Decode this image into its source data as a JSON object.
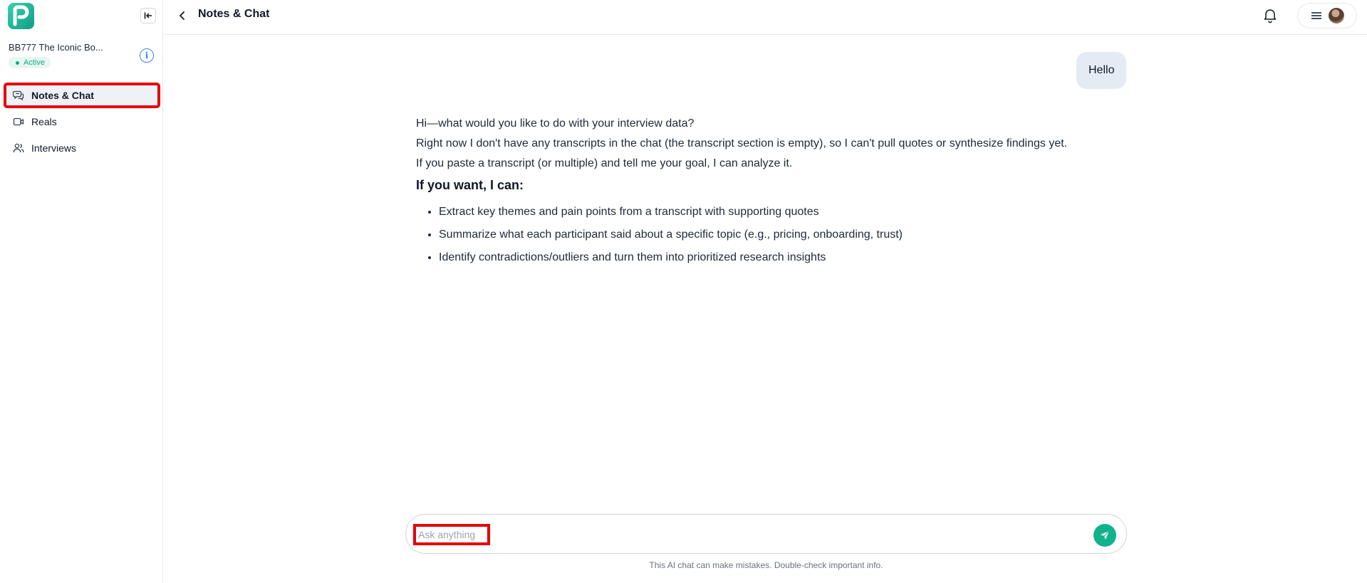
{
  "sidebar": {
    "project_name": "BB777 The Iconic Bo...",
    "status": "Active",
    "items": [
      {
        "label": "Notes & Chat",
        "icon": "chat-bubbles-icon",
        "active": true
      },
      {
        "label": "Reals",
        "icon": "video-icon",
        "active": false
      },
      {
        "label": "Interviews",
        "icon": "users-icon",
        "active": false
      }
    ]
  },
  "header": {
    "title": "Notes & Chat"
  },
  "chat": {
    "user_message": "Hello",
    "assistant": {
      "line1": "Hi—what would you like to do with your interview data?",
      "line2": "Right now I don't have any transcripts in the chat (the transcript section is empty), so I can't pull quotes or synthesize findings yet.",
      "line3": "If you paste a transcript (or multiple) and tell me your goal, I can analyze it.",
      "heading": "If you want, I can:",
      "bullets": [
        "Extract key themes and pain points from a transcript with supporting quotes",
        "Summarize what each participant said about a specific topic (e.g., pricing, onboarding, trust)",
        "Identify contradictions/outliers and turn them into prioritized research insights"
      ]
    }
  },
  "composer": {
    "placeholder": "Ask anything",
    "value": "",
    "disclaimer": "This AI chat can make mistakes. Double-check important info."
  },
  "colors": {
    "accent": "#12b28c",
    "highlight_outline": "#e5000b",
    "active_bg": "#eef2f7",
    "user_bubble": "#e5ebf2"
  }
}
